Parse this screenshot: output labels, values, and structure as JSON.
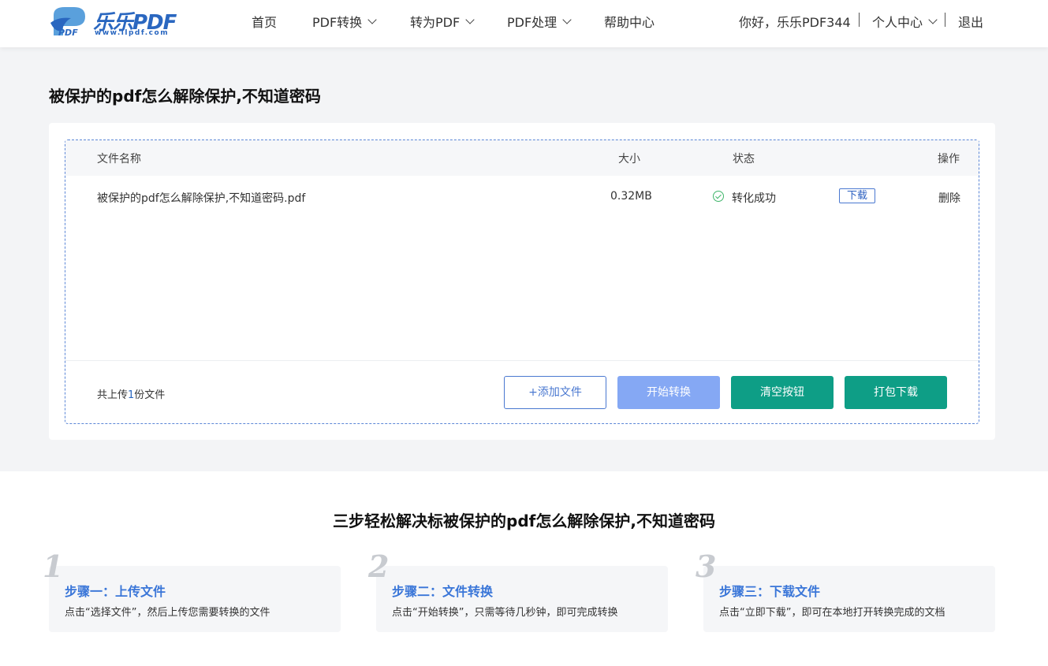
{
  "header": {
    "logo_text": "乐乐PDF",
    "logo_url": "www.llpdf.com",
    "nav": [
      {
        "label": "首页",
        "has_dropdown": false
      },
      {
        "label": "PDF转换",
        "has_dropdown": true
      },
      {
        "label": "转为PDF",
        "has_dropdown": true
      },
      {
        "label": "PDF处理",
        "has_dropdown": true
      },
      {
        "label": "帮助中心",
        "has_dropdown": false
      }
    ],
    "greeting": "你好，乐乐PDF344",
    "user_center": "个人中心",
    "logout": "退出"
  },
  "main": {
    "title": "被保护的pdf怎么解除保护,不知道密码",
    "table": {
      "columns": {
        "name": "文件名称",
        "size": "大小",
        "status": "状态",
        "action": "操作"
      },
      "rows": [
        {
          "name": "被保护的pdf怎么解除保护,不知道密码.pdf",
          "size": "0.32MB",
          "status": "转化成功",
          "download": "下载",
          "delete": "删除"
        }
      ]
    },
    "count_prefix": "共上传",
    "count_value": "1",
    "count_suffix": "份文件",
    "buttons": {
      "add": "+添加文件",
      "start": "开始转换",
      "clear": "清空按钮",
      "pack": "打包下载"
    }
  },
  "steps": {
    "title": "三步轻松解决标被保护的pdf怎么解除保护,不知道密码",
    "items": [
      {
        "num": "1",
        "head": "步骤一：上传文件",
        "desc": "点击“选择文件”，然后上传您需要转换的文件"
      },
      {
        "num": "2",
        "head": "步骤二：文件转换",
        "desc": "点击“开始转换”，只需等待几秒钟，即可完成转换"
      },
      {
        "num": "3",
        "head": "步骤三：下载文件",
        "desc": "点击“立即下载”，即可在本地打开转换完成的文档"
      }
    ]
  },
  "colors": {
    "brand_blue": "#2a67c0",
    "success_green": "#3fb56a",
    "teal_button": "#0e9e86",
    "start_button": "#85a8f4"
  }
}
